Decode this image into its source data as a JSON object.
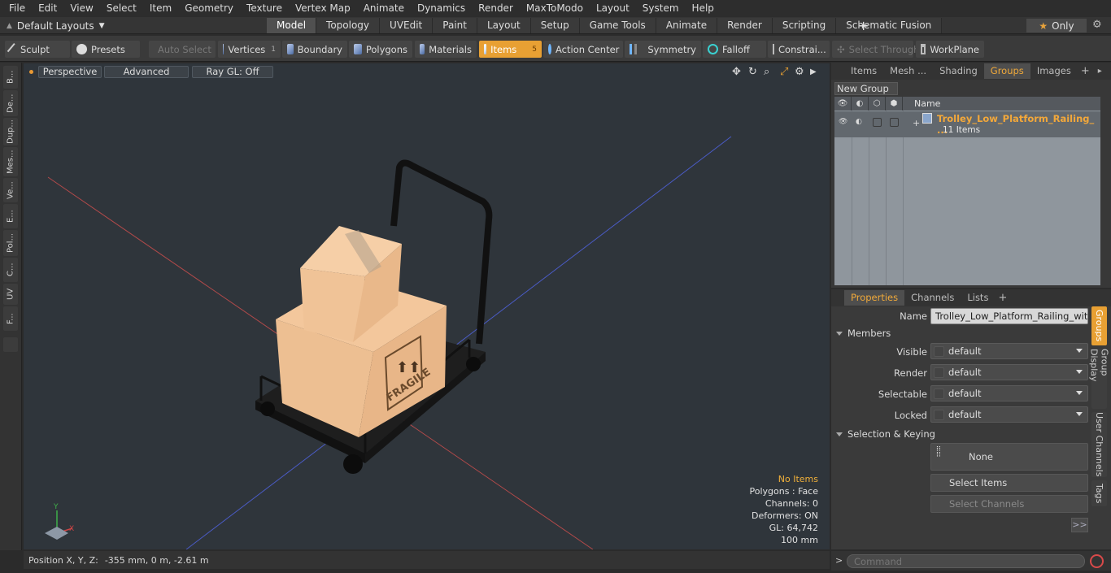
{
  "menubar": [
    "File",
    "Edit",
    "View",
    "Select",
    "Item",
    "Geometry",
    "Texture",
    "Vertex Map",
    "Animate",
    "Dynamics",
    "Render",
    "MaxToModo",
    "Layout",
    "System",
    "Help"
  ],
  "layout": {
    "current": "Default Layouts",
    "only_label": "Only",
    "add_tab": "+"
  },
  "mode_tabs": [
    "Model",
    "Topology",
    "UVEdit",
    "Paint",
    "Layout",
    "Setup",
    "Game Tools",
    "Animate",
    "Render",
    "Scripting",
    "Schematic Fusion"
  ],
  "active_mode_tab": "Model",
  "toolbar": {
    "sculpt": "Sculpt",
    "presets": "Presets",
    "auto_select": "Auto Select",
    "vertices": "Vertices",
    "vertices_count": "1",
    "boundary": "Boundary",
    "polygons": "Polygons",
    "materials": "Materials",
    "items": "Items",
    "items_count": "5",
    "action_center": "Action Center",
    "symmetry": "Symmetry",
    "falloff": "Falloff",
    "constraints": "Constrai...",
    "select_through": "Select Through",
    "workplane": "WorkPlane"
  },
  "left_strip": [
    "B...",
    "De...",
    "Dup...",
    "Mes...",
    "Ve...",
    "E...",
    "Pol...",
    "C...",
    "UV",
    "F..."
  ],
  "viewport": {
    "view_mode": "Perspective",
    "shading": "Advanced",
    "raygl": "Ray GL: Off",
    "status": {
      "items": "No Items",
      "polygons": "Polygons : Face",
      "channels": "Channels: 0",
      "deformers": "Deformers: ON",
      "gl": "GL: 64,742",
      "scale": "100 mm"
    },
    "box_text": "FRAGILE"
  },
  "position": {
    "label": "Position X, Y, Z:",
    "value": "-355 mm, 0 m, -2.61 m"
  },
  "right_top": {
    "tabs": [
      "Items",
      "Mesh ...",
      "Shading",
      "Groups",
      "Images"
    ],
    "active_tab": "Groups",
    "new_group": "New Group",
    "name_header": "Name",
    "group_name": "Trolley_Low_Platform_Railing_ ...",
    "group_count": "11 Items"
  },
  "properties": {
    "tabs": [
      "Properties",
      "Channels",
      "Lists"
    ],
    "active_tab": "Properties",
    "name_label": "Name",
    "name_value": "Trolley_Low_Platform_Railing_with_Ca",
    "members_section": "Members",
    "fields": [
      {
        "label": "Visible",
        "value": "default"
      },
      {
        "label": "Render",
        "value": "default"
      },
      {
        "label": "Selectable",
        "value": "default"
      },
      {
        "label": "Locked",
        "value": "default"
      }
    ],
    "keying_section": "Selection & Keying",
    "none_btn": "None",
    "select_items": "Select Items",
    "select_channels": "Select Channels",
    "more": ">>"
  },
  "side_tabs": [
    "Groups",
    "Group Display",
    "User Channels",
    "Tags"
  ],
  "command": {
    "prompt": ">",
    "placeholder": "Command"
  },
  "colors": {
    "accent": "#e8a033",
    "viewport_bg": "#2f353b",
    "group_highlight": "#f3a83a"
  }
}
